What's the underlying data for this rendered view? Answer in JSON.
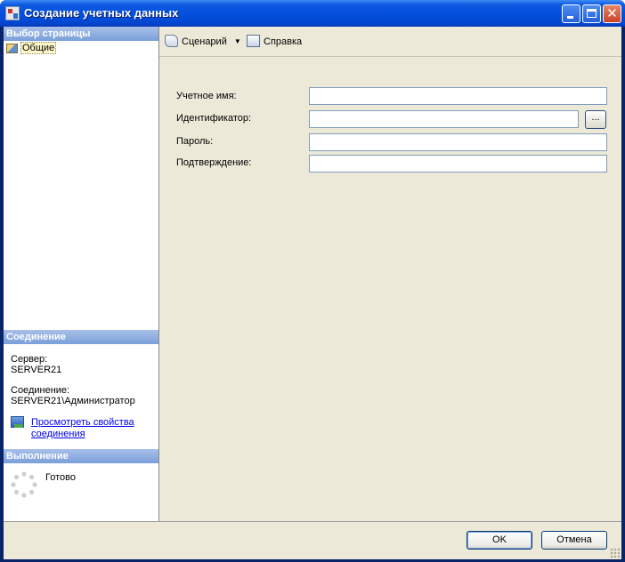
{
  "window": {
    "title": "Создание учетных данных"
  },
  "left_pane": {
    "pages_header": "Выбор страницы",
    "pages": [
      {
        "label": "Общие",
        "icon": "general-page-icon"
      }
    ],
    "connection_header": "Соединение",
    "server_label": "Сервер:",
    "server_value": "SERVER21",
    "connection_label": "Соединение:",
    "connection_value": "SERVER21\\Администратор",
    "view_props_link": "Просмотреть свойства соединения",
    "progress_header": "Выполнение",
    "progress_status": "Готово"
  },
  "toolbar": {
    "script_label": "Сценарий",
    "help_label": "Справка"
  },
  "form": {
    "account_name_label": "Учетное имя:",
    "account_name_value": "",
    "identity_label": "Идентификатор:",
    "identity_value": "",
    "browse_label": "...",
    "password_label": "Пароль:",
    "password_value": "",
    "confirm_label": "Подтверждение:",
    "confirm_value": ""
  },
  "buttons": {
    "ok_label": "OK",
    "cancel_label": "Отмена"
  },
  "colors": {
    "titlebar": "#0550dc",
    "section_header": "#7a9fda",
    "dialog_bg": "#ece9d8",
    "link": "#0000ee"
  }
}
